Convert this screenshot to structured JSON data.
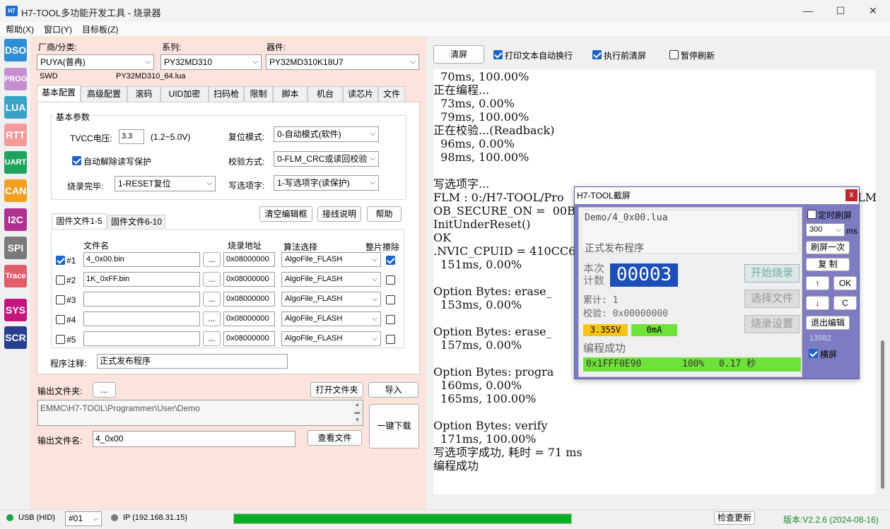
{
  "window": {
    "title": "H7-TOOL多功能开发工具 - 烧录器",
    "icon": "H7"
  },
  "menu": [
    "帮助(X)",
    "窗口(Y)",
    "目标板(Z)"
  ],
  "sidebar": [
    {
      "label": "DSO",
      "color": "#2f8ed6"
    },
    {
      "label": "PROG",
      "color": "#c58ecf"
    },
    {
      "label": "LUA",
      "color": "#3aa1c7"
    },
    {
      "label": "RTT",
      "color": "#f39a9a"
    },
    {
      "label": "UART",
      "color": "#1fa35c"
    },
    {
      "label": "CAN",
      "color": "#f2a020"
    },
    {
      "label": "I2C",
      "color": "#b0318f"
    },
    {
      "label": "SPI",
      "color": "#7a7a7a"
    },
    {
      "label": "Trace",
      "color": "#e25d6a"
    },
    {
      "label": "SYS",
      "color": "#c4157f"
    },
    {
      "label": "SCR",
      "color": "#273f8d"
    }
  ],
  "device": {
    "vendor_label": "厂商/分类:",
    "vendor": "PUYA(普冉)",
    "series_label": "系列:",
    "series": "PY32MD310",
    "part_label": "器件:",
    "part": "PY32MD310K18U7",
    "interface": "SWD",
    "flm": "PY32MD310_64.lua"
  },
  "tabs": [
    "基本配置",
    "高级配置",
    "滚码",
    "UID加密",
    "扫码枪",
    "限制",
    "脚本",
    "机台",
    "读芯片",
    "文件"
  ],
  "basic": {
    "group_title": "基本参数",
    "tvcc_label": "TVCC电压:",
    "tvcc": "3.3",
    "tvcc_range": "(1.2~5.0V)",
    "reset_label": "复位模式:",
    "reset": "0-自动模式(软件)",
    "auto_unlock": "自动解除读写保护",
    "verify_label": "校验方式:",
    "verify": "0-FLM_CRC或读回校验",
    "done_label": "烧录完毕:",
    "done": "1-RESET复位",
    "option_label": "写选项字:",
    "option": "1-写选项字(读保护)"
  },
  "files": {
    "tab1": "固件文件1-5",
    "tab2": "固件文件6-10",
    "clear_btn": "清空编辑框",
    "wiring_btn": "接线说明",
    "help_btn": "帮助",
    "col_file": "文件名",
    "col_addr": "烧录地址",
    "col_algo": "算法选择",
    "col_erase": "整片擦除",
    "rows": [
      {
        "idx": "#1",
        "checked": true,
        "file": "4_0x00.bin",
        "addr": "0x08000000",
        "algo": "AlgoFile_FLASH",
        "erase": true
      },
      {
        "idx": "#2",
        "checked": false,
        "file": "1K_0xFF.bin",
        "addr": "0x08000000",
        "algo": "AlgoFile_FLASH",
        "erase": false
      },
      {
        "idx": "#3",
        "checked": false,
        "file": "",
        "addr": "0x08000000",
        "algo": "AlgoFile_FLASH",
        "erase": false
      },
      {
        "idx": "#4",
        "checked": false,
        "file": "",
        "addr": "0x08000000",
        "algo": "AlgoFile_FLASH",
        "erase": false
      },
      {
        "idx": "#5",
        "checked": false,
        "file": "",
        "addr": "0x08000000",
        "algo": "AlgoFile_FLASH",
        "erase": false
      }
    ],
    "browse": "...",
    "note_label": "程序注释:",
    "note": "正式发布程序"
  },
  "output": {
    "folder_label": "输出文件夹:",
    "folder_btn": "...",
    "open_folder_btn": "打开文件夹",
    "import_btn": "导入",
    "path": "EMMC\\H7-TOOL\\Programmer\\User\\Demo",
    "download_btn": "一键下载",
    "name_label": "输出文件名:",
    "name": "4_0x00",
    "view_btn": "查看文件"
  },
  "console_toolbar": {
    "clear": "清屏",
    "wrap": "打印文本自动换行",
    "clear_before": "执行前清屏",
    "pause": "暂停刷新"
  },
  "console_lines": [
    "  70ms, 100.00%",
    "正在编程...",
    "  73ms, 0.00%",
    "  79ms, 100.00%",
    "正在校验...(Readback)",
    "  96ms, 0.00%",
    "  98ms, 100.00%",
    "",
    "写选项字...",
    "FLM : 0:/H7-TOOL/Pro",
    "OB_SECURE_ON =  00BE",
    "InitUnderReset()",
    "OK",
    ".NVIC_CPUID = 410CC6",
    "  151ms, 0.00%",
    "",
    "Option Bytes: erase_",
    "  153ms, 0.00%",
    "",
    "Option Bytes: erase_",
    "  157ms, 0.00%",
    "",
    "Option Bytes: progra",
    "  160ms, 0.00%",
    "  165ms, 100.00%",
    "",
    "Option Bytes: verify",
    "  171ms, 100.00%",
    "写选项字成功, 耗时 = 71 ms",
    "编程成功"
  ],
  "console_tail": "LM",
  "screen": {
    "title": "H7-TOOL截屏",
    "close": "x",
    "file": "Demo/4_0x00.lua",
    "note": "正式发布程序",
    "count_label1": "本次",
    "count_label2": "计数",
    "count": "00003",
    "total": "累计: 1",
    "checksum": "校验: 0x00000000",
    "voltage": "3.355V",
    "current": "0mA",
    "status": "编程成功",
    "addr": "0x1FFF0E90",
    "percent": "100%",
    "time": "0.17 秒",
    "start_btn": "开始烧录",
    "select_btn": "选择文件",
    "settings_btn": "烧录设置",
    "timer_label": "定时刷屏",
    "interval": "300",
    "unit": "ms",
    "refresh_btn": "刷屏一次",
    "copy_btn": "复 制",
    "up_btn": "↑",
    "ok_btn": "OK",
    "down_btn": "↓",
    "c_btn": "C",
    "exit_btn": "退出编辑",
    "serial": "13582",
    "landscape": "横屏"
  },
  "status": {
    "usb": "USB (HID)",
    "port": "#01",
    "ip": "IP (192.168.31.15)",
    "progress": 1.0,
    "update_btn": "检查更新",
    "version": "版本:V2.2.6 (2024-08-16)"
  }
}
